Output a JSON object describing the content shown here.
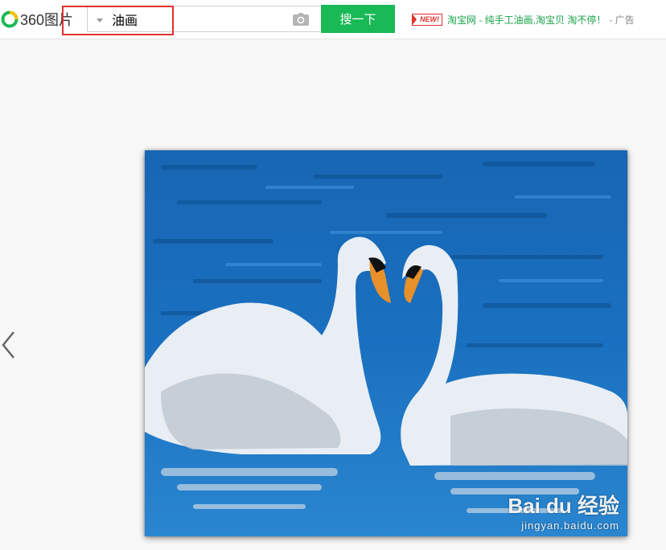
{
  "header": {
    "logo_text": "360图片",
    "search": {
      "query": "油画"
    },
    "search_button_label": "搜一下"
  },
  "ad": {
    "badge": "NEW!",
    "link_text": "淘宝网 - 纯手工油画,淘宝贝 淘不停！",
    "suffix": "- 广告"
  },
  "image": {
    "watermark_brand": "Bai du 经验",
    "watermark_url": "jingyan.baidu.com"
  },
  "colors": {
    "accent_green": "#19b955",
    "highlight_red": "#e0312d",
    "water_blue": "#1b67b0"
  },
  "icons": [
    "360-logo-icon",
    "dropdown-arrow-icon",
    "camera-icon",
    "chevron-left-icon"
  ]
}
